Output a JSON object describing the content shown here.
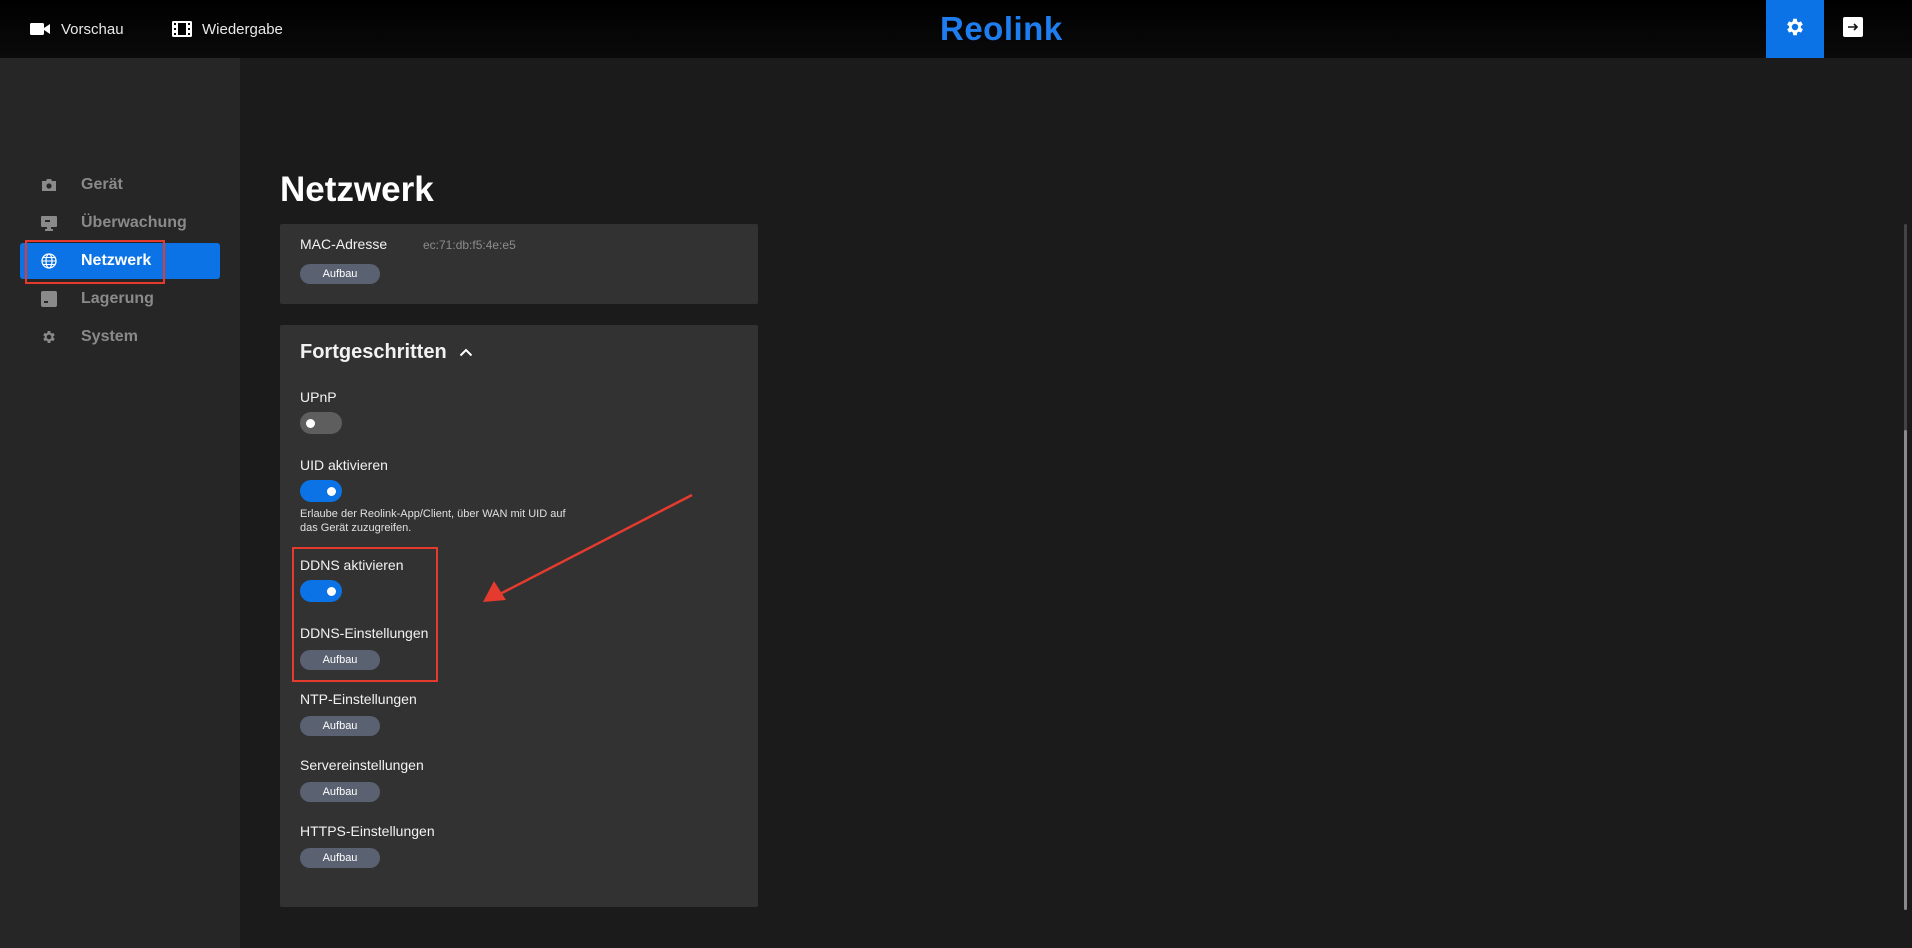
{
  "topbar": {
    "preview_label": "Vorschau",
    "playback_label": "Wiedergabe",
    "brand": "Reolink"
  },
  "sidebar": {
    "items": [
      {
        "label": "Gerät",
        "icon": "camera-icon"
      },
      {
        "label": "Überwachung",
        "icon": "monitor-icon"
      },
      {
        "label": "Netzwerk",
        "icon": "globe-icon",
        "active": true
      },
      {
        "label": "Lagerung",
        "icon": "storage-icon"
      },
      {
        "label": "System",
        "icon": "gear-icon"
      }
    ]
  },
  "main": {
    "title": "Netzwerk",
    "mac": {
      "label": "MAC-Adresse",
      "value": "ec:71:db:f5:4e:e5",
      "button": "Aufbau"
    },
    "advanced": {
      "title": "Fortgeschritten",
      "upnp": {
        "label": "UPnP",
        "enabled": false
      },
      "uid": {
        "label": "UID aktivieren",
        "enabled": true,
        "description": "Erlaube der Reolink-App/Client, über WAN mit UID auf das Gerät zuzugreifen."
      },
      "ddns": {
        "label": "DDNS aktivieren",
        "enabled": true
      },
      "ddns_settings": {
        "label": "DDNS-Einstellungen",
        "button": "Aufbau"
      },
      "ntp_settings": {
        "label": "NTP-Einstellungen",
        "button": "Aufbau"
      },
      "server_settings": {
        "label": "Servereinstellungen",
        "button": "Aufbau"
      },
      "https_settings": {
        "label": "HTTPS-Einstellungen",
        "button": "Aufbau"
      }
    }
  },
  "colors": {
    "accent": "#0b73e5",
    "highlight": "#e53b2f",
    "card": "#323232",
    "background": "#1b1b1b"
  }
}
